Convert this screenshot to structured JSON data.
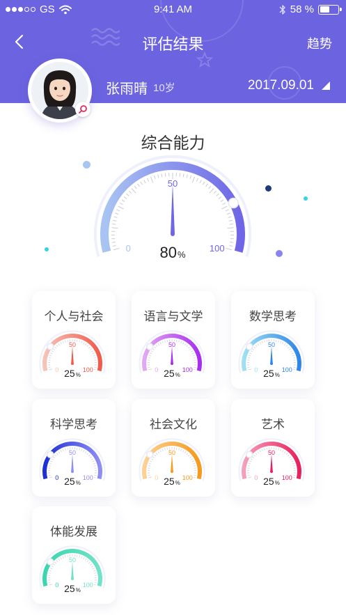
{
  "status_bar": {
    "carrier": "GS",
    "time": "9:41 AM",
    "battery_text": "58 %",
    "battery_level": 0.58
  },
  "nav": {
    "title": "评估结果",
    "right_label": "趋势"
  },
  "user": {
    "name": "张雨晴",
    "age": "10岁",
    "date": "2017.09.01"
  },
  "overall": {
    "title": "综合能力",
    "value": 80,
    "value_text": "80",
    "unit": "%",
    "min_label": "0",
    "mid_label": "50",
    "max_label": "100",
    "colors": [
      "#a9c4f2",
      "#6e66e6"
    ]
  },
  "categories": [
    {
      "label": "个人与社会",
      "value": 25,
      "value_text": "25",
      "unit": "%",
      "min_label": "0",
      "mid_label": "50",
      "max_label": "100",
      "colors": [
        "#f7c3b8",
        "#f25a4a"
      ]
    },
    {
      "label": "语言与文学",
      "value": 25,
      "value_text": "25",
      "unit": "%",
      "min_label": "0",
      "mid_label": "50",
      "max_label": "100",
      "colors": [
        "#e2a8f4",
        "#a72ef0"
      ]
    },
    {
      "label": "数学思考",
      "value": 25,
      "value_text": "25",
      "unit": "%",
      "min_label": "0",
      "mid_label": "50",
      "max_label": "100",
      "colors": [
        "#9fe0f2",
        "#2f86ea"
      ]
    },
    {
      "label": "科学思考",
      "value": 25,
      "value_text": "25",
      "unit": "%",
      "min_label": "0",
      "mid_label": "50",
      "max_label": "100",
      "colors": [
        "#1c2fd6",
        "#8e8ef5"
      ]
    },
    {
      "label": "社会文化",
      "value": 25,
      "value_text": "25",
      "unit": "%",
      "min_label": "0",
      "mid_label": "50",
      "max_label": "100",
      "colors": [
        "#fdd195",
        "#f59a1c"
      ]
    },
    {
      "label": "艺术",
      "value": 25,
      "value_text": "25",
      "unit": "%",
      "min_label": "0",
      "mid_label": "50",
      "max_label": "100",
      "colors": [
        "#f5a0bd",
        "#e8205c"
      ]
    },
    {
      "label": "体能发展",
      "value": 25,
      "value_text": "25",
      "unit": "%",
      "min_label": "0",
      "mid_label": "50",
      "max_label": "100",
      "colors": [
        "#39d6b0",
        "#72e2c8"
      ]
    }
  ]
}
